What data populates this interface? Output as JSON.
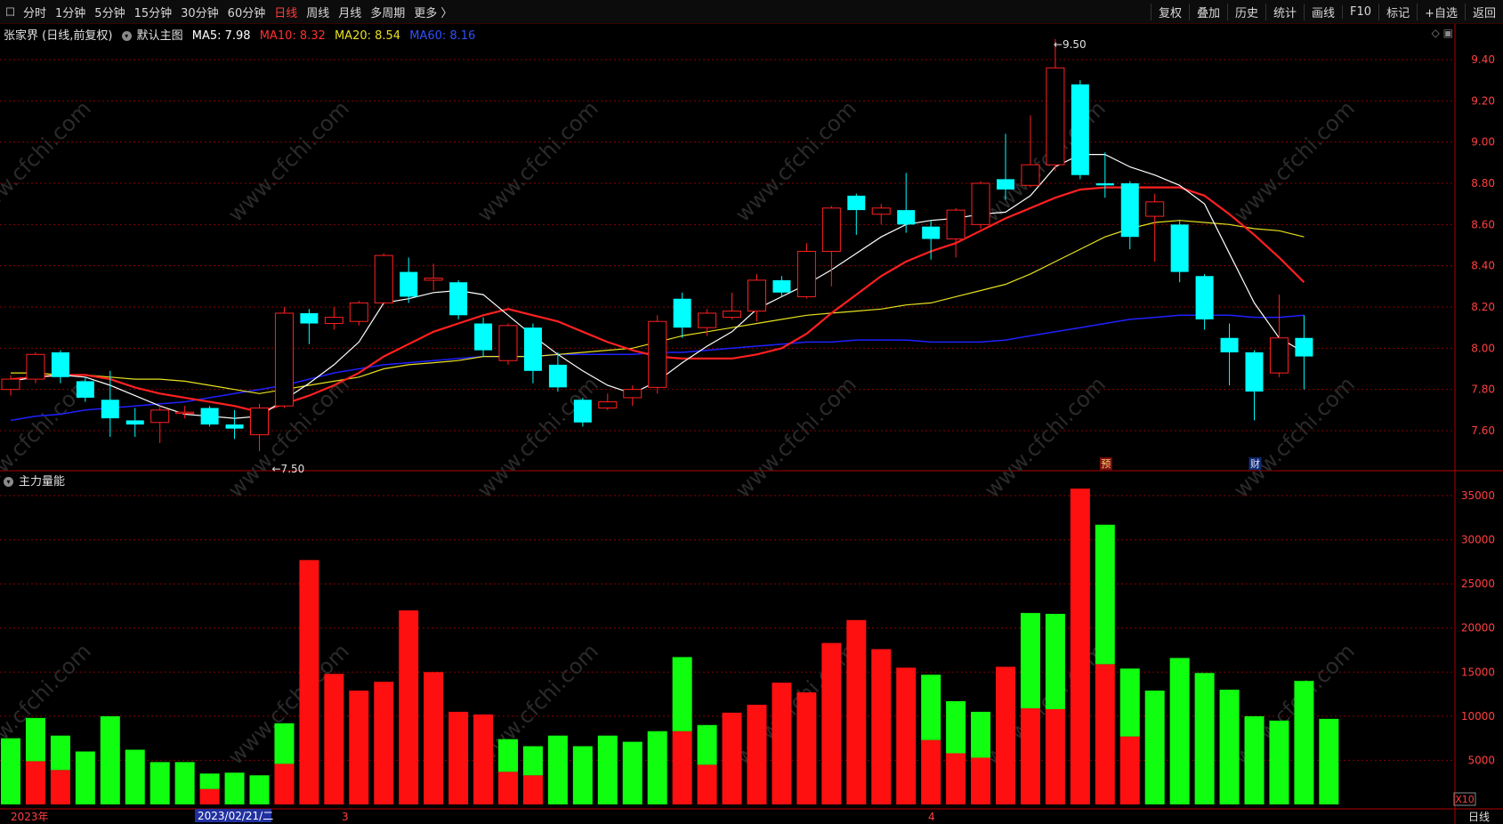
{
  "toolbar": {
    "periods": [
      "分时",
      "1分钟",
      "5分钟",
      "15分钟",
      "30分钟",
      "60分钟",
      "日线",
      "周线",
      "月线",
      "多周期",
      "更多 〉"
    ],
    "active_period": "日线",
    "right_buttons": [
      "复权",
      "叠加",
      "历史",
      "统计",
      "画线",
      "F10",
      "标记",
      "+自选",
      "返回"
    ]
  },
  "legend": {
    "stock_name": "张家界",
    "period_info": "(日线,前复权)",
    "main_indicator": "默认主图",
    "ma5": "MA5: 7.98",
    "ma10": "MA10: 8.32",
    "ma20": "MA20: 8.54",
    "ma60": "MA60: 8.16",
    "volume_indicator": "主力量能"
  },
  "annotations": {
    "high": "9.50",
    "low": "7.50",
    "marker_1": "预",
    "marker_2": "财",
    "x10": "X10",
    "watermark": "www.cfchi.com"
  },
  "bottom": {
    "year_label": "2023年",
    "cursor_date": "2023/02/21/二",
    "month_3": "3",
    "month_4": "4",
    "period_label": "日线"
  },
  "colors": {
    "up": "#ff2020",
    "down": "#00ffff",
    "vol_up": "#ff1010",
    "vol_down": "#10ff10",
    "ma5": "#ffffff",
    "ma10": "#ff2020",
    "ma20": "#e8e020",
    "ma60": "#2020ff",
    "grid": "#8a0000"
  },
  "chart_data": [
    {
      "type": "candlestick",
      "title": "张家界 (日线,前复权)",
      "y_ticks": [
        7.6,
        7.8,
        8.0,
        8.2,
        8.4,
        8.6,
        8.8,
        9.0,
        9.2,
        9.4
      ],
      "ylim": [
        7.42,
        9.58
      ],
      "candles": [
        {
          "o": 7.8,
          "c": 7.85,
          "h": 7.87,
          "l": 7.77
        },
        {
          "o": 7.85,
          "c": 7.97,
          "h": 7.98,
          "l": 7.83
        },
        {
          "o": 7.98,
          "c": 7.86,
          "h": 7.99,
          "l": 7.83
        },
        {
          "o": 7.84,
          "c": 7.76,
          "h": 7.86,
          "l": 7.74
        },
        {
          "o": 7.75,
          "c": 7.66,
          "h": 7.89,
          "l": 7.57
        },
        {
          "o": 7.65,
          "c": 7.63,
          "h": 7.71,
          "l": 7.57
        },
        {
          "o": 7.64,
          "c": 7.7,
          "h": 7.72,
          "l": 7.54
        },
        {
          "o": 7.69,
          "c": 7.69,
          "h": 7.72,
          "l": 7.66
        },
        {
          "o": 7.71,
          "c": 7.63,
          "h": 7.72,
          "l": 7.62
        },
        {
          "o": 7.63,
          "c": 7.61,
          "h": 7.7,
          "l": 7.56
        },
        {
          "o": 7.58,
          "c": 7.71,
          "h": 7.73,
          "l": 7.5
        },
        {
          "o": 7.72,
          "c": 8.17,
          "h": 8.2,
          "l": 7.71
        },
        {
          "o": 8.17,
          "c": 8.12,
          "h": 8.19,
          "l": 8.02
        },
        {
          "o": 8.12,
          "c": 8.15,
          "h": 8.2,
          "l": 8.09
        },
        {
          "o": 8.13,
          "c": 8.22,
          "h": 8.23,
          "l": 8.11
        },
        {
          "o": 8.22,
          "c": 8.45,
          "h": 8.46,
          "l": 8.21
        },
        {
          "o": 8.37,
          "c": 8.25,
          "h": 8.44,
          "l": 8.22
        },
        {
          "o": 8.33,
          "c": 8.34,
          "h": 8.41,
          "l": 8.28
        },
        {
          "o": 8.32,
          "c": 8.16,
          "h": 8.33,
          "l": 8.14
        },
        {
          "o": 8.12,
          "c": 7.99,
          "h": 8.15,
          "l": 7.96
        },
        {
          "o": 7.94,
          "c": 8.11,
          "h": 8.12,
          "l": 7.92
        },
        {
          "o": 8.1,
          "c": 7.89,
          "h": 8.12,
          "l": 7.83
        },
        {
          "o": 7.92,
          "c": 7.81,
          "h": 7.98,
          "l": 7.79
        },
        {
          "o": 7.75,
          "c": 7.64,
          "h": 7.76,
          "l": 7.62
        },
        {
          "o": 7.71,
          "c": 7.74,
          "h": 7.78,
          "l": 7.7
        },
        {
          "o": 7.76,
          "c": 7.8,
          "h": 7.82,
          "l": 7.72
        },
        {
          "o": 7.81,
          "c": 8.13,
          "h": 8.16,
          "l": 7.78
        },
        {
          "o": 8.24,
          "c": 8.1,
          "h": 8.27,
          "l": 8.05
        },
        {
          "o": 8.1,
          "c": 8.17,
          "h": 8.19,
          "l": 8.06
        },
        {
          "o": 8.15,
          "c": 8.18,
          "h": 8.27,
          "l": 8.14
        },
        {
          "o": 8.18,
          "c": 8.33,
          "h": 8.36,
          "l": 8.13
        },
        {
          "o": 8.33,
          "c": 8.27,
          "h": 8.35,
          "l": 8.25
        },
        {
          "o": 8.25,
          "c": 8.47,
          "h": 8.51,
          "l": 8.24
        },
        {
          "o": 8.47,
          "c": 8.68,
          "h": 8.69,
          "l": 8.3
        },
        {
          "o": 8.74,
          "c": 8.67,
          "h": 8.75,
          "l": 8.55
        },
        {
          "o": 8.65,
          "c": 8.68,
          "h": 8.7,
          "l": 8.6
        },
        {
          "o": 8.67,
          "c": 8.6,
          "h": 8.85,
          "l": 8.56
        },
        {
          "o": 8.59,
          "c": 8.53,
          "h": 8.62,
          "l": 8.43
        },
        {
          "o": 8.53,
          "c": 8.67,
          "h": 8.68,
          "l": 8.44
        },
        {
          "o": 8.6,
          "c": 8.8,
          "h": 8.81,
          "l": 8.58
        },
        {
          "o": 8.82,
          "c": 8.77,
          "h": 9.04,
          "l": 8.72
        },
        {
          "o": 8.79,
          "c": 8.89,
          "h": 9.13,
          "l": 8.78
        },
        {
          "o": 8.89,
          "c": 9.36,
          "h": 9.5,
          "l": 8.86
        },
        {
          "o": 9.28,
          "c": 8.84,
          "h": 9.3,
          "l": 8.82
        },
        {
          "o": 8.8,
          "c": 8.79,
          "h": 8.95,
          "l": 8.73
        },
        {
          "o": 8.8,
          "c": 8.54,
          "h": 8.81,
          "l": 8.48
        },
        {
          "o": 8.64,
          "c": 8.71,
          "h": 8.75,
          "l": 8.42
        },
        {
          "o": 8.6,
          "c": 8.37,
          "h": 8.62,
          "l": 8.32
        },
        {
          "o": 8.35,
          "c": 8.14,
          "h": 8.36,
          "l": 8.09
        },
        {
          "o": 8.05,
          "c": 7.98,
          "h": 8.12,
          "l": 7.82
        },
        {
          "o": 7.98,
          "c": 7.79,
          "h": 7.99,
          "l": 7.65
        },
        {
          "o": 7.88,
          "c": 8.05,
          "h": 8.26,
          "l": 7.86
        },
        {
          "o": 8.05,
          "c": 7.96,
          "h": 8.16,
          "l": 7.8
        }
      ],
      "ma5": [
        7.84,
        7.86,
        7.87,
        7.86,
        7.82,
        7.77,
        7.72,
        7.68,
        7.67,
        7.66,
        7.67,
        7.75,
        7.83,
        7.92,
        8.03,
        8.22,
        8.24,
        8.27,
        8.28,
        8.26,
        8.16,
        8.06,
        7.97,
        7.89,
        7.82,
        7.78,
        7.84,
        7.93,
        8.01,
        8.08,
        8.19,
        8.25,
        8.31,
        8.38,
        8.46,
        8.54,
        8.6,
        8.62,
        8.63,
        8.65,
        8.66,
        8.74,
        8.88,
        8.94,
        8.94,
        8.88,
        8.84,
        8.79,
        8.7,
        8.46,
        8.22,
        8.05,
        7.98
      ],
      "ma10": [
        7.85,
        7.86,
        7.87,
        7.87,
        7.85,
        7.81,
        7.78,
        7.76,
        7.74,
        7.72,
        7.69,
        7.73,
        7.77,
        7.82,
        7.88,
        7.96,
        8.02,
        8.08,
        8.12,
        8.16,
        8.19,
        8.16,
        8.13,
        8.08,
        8.03,
        7.99,
        7.96,
        7.95,
        7.95,
        7.95,
        7.97,
        8.0,
        8.07,
        8.17,
        8.26,
        8.35,
        8.42,
        8.47,
        8.51,
        8.57,
        8.63,
        8.68,
        8.73,
        8.77,
        8.78,
        8.78,
        8.78,
        8.78,
        8.74,
        8.65,
        8.55,
        8.44,
        8.32
      ],
      "ma20": [
        7.88,
        7.88,
        7.87,
        7.87,
        7.86,
        7.85,
        7.85,
        7.84,
        7.82,
        7.8,
        7.78,
        7.8,
        7.82,
        7.84,
        7.86,
        7.9,
        7.92,
        7.93,
        7.94,
        7.96,
        7.96,
        7.96,
        7.97,
        7.98,
        7.99,
        8.0,
        8.03,
        8.06,
        8.08,
        8.1,
        8.12,
        8.14,
        8.16,
        8.17,
        8.18,
        8.19,
        8.21,
        8.22,
        8.25,
        8.28,
        8.31,
        8.36,
        8.42,
        8.48,
        8.54,
        8.58,
        8.61,
        8.62,
        8.61,
        8.6,
        8.58,
        8.57,
        8.54
      ],
      "ma60": [
        7.65,
        7.67,
        7.68,
        7.7,
        7.71,
        7.72,
        7.73,
        7.74,
        7.76,
        7.78,
        7.8,
        7.82,
        7.85,
        7.88,
        7.9,
        7.92,
        7.93,
        7.94,
        7.95,
        7.96,
        7.96,
        7.96,
        7.97,
        7.97,
        7.97,
        7.97,
        7.98,
        7.98,
        7.99,
        8.0,
        8.01,
        8.02,
        8.03,
        8.03,
        8.04,
        8.04,
        8.04,
        8.03,
        8.03,
        8.03,
        8.04,
        8.06,
        8.08,
        8.1,
        8.12,
        8.14,
        8.15,
        8.16,
        8.16,
        8.16,
        8.15,
        8.15,
        8.16
      ]
    },
    {
      "type": "bar",
      "title": "主力量能",
      "y_ticks": [
        5000,
        10000,
        15000,
        20000,
        25000,
        30000,
        35000
      ],
      "ylim": [
        0,
        36000
      ],
      "volumes": [
        {
          "total": 7500,
          "red": 0
        },
        {
          "total": 9800,
          "red": 4900
        },
        {
          "total": 7800,
          "red": 3900
        },
        {
          "total": 6000,
          "red": 0
        },
        {
          "total": 10000,
          "red": 0
        },
        {
          "total": 6200,
          "red": 0
        },
        {
          "total": 4800,
          "red": 0
        },
        {
          "total": 4800,
          "red": 0
        },
        {
          "total": 3500,
          "red": 1750
        },
        {
          "total": 3600,
          "red": 0
        },
        {
          "total": 3300,
          "red": 0
        },
        {
          "total": 9200,
          "red": 4600
        },
        {
          "total": 27700,
          "red": 27700
        },
        {
          "total": 14800,
          "red": 14800
        },
        {
          "total": 12900,
          "red": 12900
        },
        {
          "total": 13900,
          "red": 13900
        },
        {
          "total": 22000,
          "red": 22000
        },
        {
          "total": 15000,
          "red": 15000
        },
        {
          "total": 10500,
          "red": 10500
        },
        {
          "total": 10200,
          "red": 10200
        },
        {
          "total": 7400,
          "red": 3700
        },
        {
          "total": 6600,
          "red": 3300
        },
        {
          "total": 7800,
          "red": 0
        },
        {
          "total": 6600,
          "red": 0
        },
        {
          "total": 7800,
          "red": 0
        },
        {
          "total": 7100,
          "red": 0
        },
        {
          "total": 8300,
          "red": 0
        },
        {
          "total": 16700,
          "red": 8300
        },
        {
          "total": 9000,
          "red": 4500
        },
        {
          "total": 10400,
          "red": 10400
        },
        {
          "total": 11300,
          "red": 11300
        },
        {
          "total": 13800,
          "red": 13800
        },
        {
          "total": 12700,
          "red": 12700
        },
        {
          "total": 18300,
          "red": 18300
        },
        {
          "total": 20900,
          "red": 20900
        },
        {
          "total": 17600,
          "red": 17600
        },
        {
          "total": 15500,
          "red": 15500
        },
        {
          "total": 14700,
          "red": 7300
        },
        {
          "total": 11700,
          "red": 5800
        },
        {
          "total": 10500,
          "red": 5300
        },
        {
          "total": 15600,
          "red": 15600
        },
        {
          "total": 21700,
          "red": 10900
        },
        {
          "total": 21600,
          "red": 10800
        },
        {
          "total": 35800,
          "red": 35800
        },
        {
          "total": 31700,
          "red": 15900
        },
        {
          "total": 15400,
          "red": 7700
        },
        {
          "total": 12900,
          "red": 0
        },
        {
          "total": 16600,
          "red": 0
        },
        {
          "total": 14900,
          "red": 0
        },
        {
          "total": 13000,
          "red": 0
        },
        {
          "total": 10000,
          "red": 0
        },
        {
          "total": 9500,
          "red": 0
        },
        {
          "total": 14000,
          "red": 0
        },
        {
          "total": 9700,
          "red": 0
        }
      ]
    }
  ]
}
